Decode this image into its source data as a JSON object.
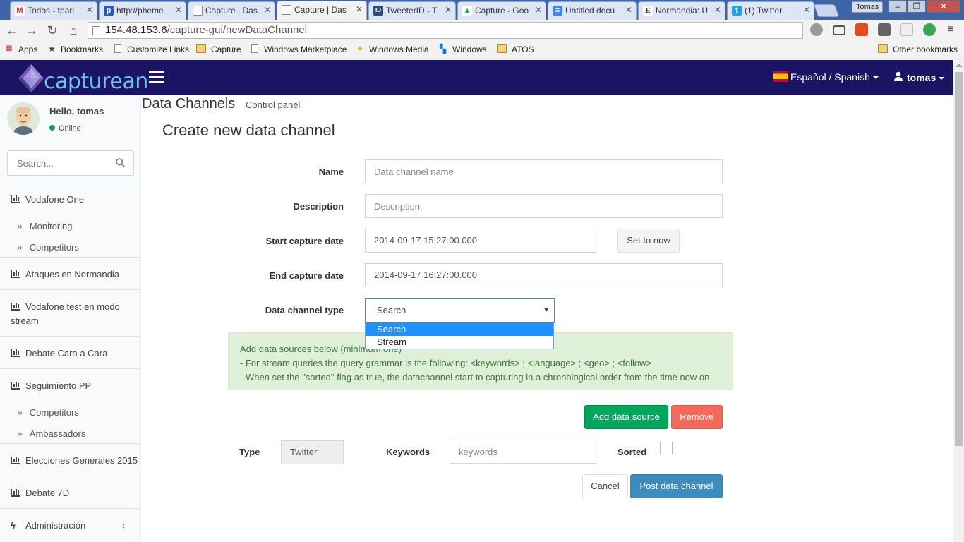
{
  "browser": {
    "tabs": [
      {
        "title": "Todos - tpari",
        "icon": "gmail-icon",
        "color": "#d93025",
        "glyph": "M"
      },
      {
        "title": "http://pheme",
        "icon": "pheme-icon",
        "color": "#2a56c6",
        "glyph": "p"
      },
      {
        "title": "Capture | Das",
        "icon": "page-icon",
        "color": "#9aa0a6",
        "glyph": ""
      },
      {
        "title": "Capture | Das",
        "icon": "page-icon",
        "color": "#9aa0a6",
        "glyph": ""
      },
      {
        "title": "TweeterID - T",
        "icon": "tweeterid-icon",
        "color": "#2c4a7c",
        "glyph": "ID"
      },
      {
        "title": "Capture - Goo",
        "icon": "google-drive-icon",
        "color": "#1fa463",
        "glyph": "▲"
      },
      {
        "title": "Untitled docu",
        "icon": "google-docs-icon",
        "color": "#4285f4",
        "glyph": "≡"
      },
      {
        "title": "Normandia: U",
        "icon": "elpais-icon",
        "color": "#333333",
        "glyph": "E"
      },
      {
        "title": "(1) Twitter",
        "icon": "twitter-icon",
        "color": "#1da1f2",
        "glyph": "t"
      }
    ],
    "window_user": "Tomas",
    "address": {
      "host": "154.48.153.6",
      "path": "/capture-gui/newDataChannel"
    },
    "bookmarks": [
      {
        "label": "Apps",
        "icon": "apps-icon"
      },
      {
        "label": "Bookmarks",
        "icon": "star-icon"
      },
      {
        "label": "Customize Links",
        "icon": "page-icon"
      },
      {
        "label": "Capture",
        "icon": "folder-icon"
      },
      {
        "label": "Windows Marketplace",
        "icon": "page-icon"
      },
      {
        "label": "Windows Media",
        "icon": "windows-media-icon"
      },
      {
        "label": "Windows",
        "icon": "windows-icon"
      },
      {
        "label": "ATOS",
        "icon": "folder-icon"
      }
    ],
    "other_bookmarks": "Other bookmarks"
  },
  "header": {
    "logo_text": "capturean",
    "language": "Español / Spanish",
    "user": "tomas"
  },
  "sidebar": {
    "greeting": "Hello, tomas",
    "status": "Online",
    "search_placeholder": "Search...",
    "menu": [
      {
        "label": "Vodafone One",
        "subitems": [
          "Monitoring",
          "Competitors"
        ]
      },
      {
        "label": "Ataques en Normandia"
      },
      {
        "label": "Vodafone test en modo stream"
      },
      {
        "label": "Debate Cara a Cara"
      },
      {
        "label": "Seguimiento PP",
        "subitems": [
          "Competitors",
          "Ambassadors"
        ]
      },
      {
        "label": "Elecciones Generales 2015"
      },
      {
        "label": "Debate 7D"
      },
      {
        "label": "Administración"
      }
    ]
  },
  "page": {
    "title": "Data Channels",
    "subtitle": "Control panel",
    "box_title": "Create new data channel"
  },
  "form": {
    "name": {
      "label": "Name",
      "placeholder": "Data channel name"
    },
    "description": {
      "label": "Description",
      "placeholder": "Description"
    },
    "start": {
      "label": "Start capture date",
      "value": "2014-09-17 15:27:00.000"
    },
    "set_now": "Set to now",
    "end": {
      "label": "End capture date",
      "value": "2014-09-17 16:27:00.000"
    },
    "type": {
      "label": "Data channel type",
      "value": "Search",
      "options": [
        "Search",
        "Stream"
      ],
      "highlighted": "Search"
    },
    "info": [
      "Add data sources below (minimum one)",
      "- For stream queries the query grammar is the following: <keywords> ; <language> ; <geo> ; <follow>",
      "- When set the \"sorted\" flag as true, the datachannel start to capturing in a chronological order from the time now on"
    ],
    "add_source": "Add data source",
    "remove": "Remove",
    "source": {
      "type_label": "Type",
      "type_value": "Twitter",
      "keywords_label": "Keywords",
      "keywords_placeholder": "keywords",
      "sorted_label": "Sorted",
      "sorted": false
    },
    "cancel": "Cancel",
    "post": "Post data channel"
  },
  "colors": {
    "header": "#1b1464",
    "primary": "#3c8dbc",
    "success": "#00a65a",
    "danger": "#f36a5a",
    "callout_bg": "#dff0d8",
    "callout_text": "#3c763d"
  }
}
